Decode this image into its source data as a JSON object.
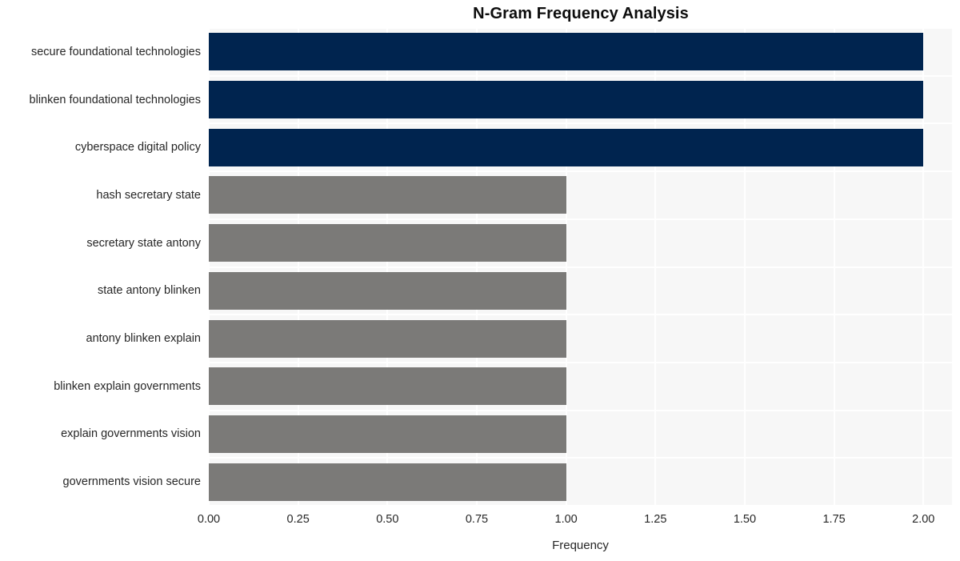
{
  "chart_data": {
    "type": "bar",
    "orientation": "horizontal",
    "title": "N-Gram Frequency Analysis",
    "xlabel": "Frequency",
    "ylabel": "",
    "xlim": [
      0,
      2.08
    ],
    "xticks": [
      "0.00",
      "0.25",
      "0.50",
      "0.75",
      "1.00",
      "1.25",
      "1.50",
      "1.75",
      "2.00"
    ],
    "xtick_values": [
      0,
      0.25,
      0.5,
      0.75,
      1.0,
      1.25,
      1.5,
      1.75,
      2.0
    ],
    "grid": true,
    "legend": "none",
    "categories": [
      "secure foundational technologies",
      "blinken foundational technologies",
      "cyberspace digital policy",
      "hash secretary state",
      "secretary state antony",
      "state antony blinken",
      "antony blinken explain",
      "blinken explain governments",
      "explain governments vision",
      "governments vision secure"
    ],
    "values": [
      2,
      2,
      2,
      1,
      1,
      1,
      1,
      1,
      1,
      1
    ],
    "bar_colors": [
      "#00244f",
      "#00244f",
      "#00244f",
      "#7b7a78",
      "#7b7a78",
      "#7b7a78",
      "#7b7a78",
      "#7b7a78",
      "#7b7a78",
      "#7b7a78"
    ],
    "colors": {
      "highlight": "#00244f",
      "standard": "#7b7a78",
      "plot_background": "#f7f7f7",
      "figure_background": "#ffffff",
      "gridline": "#ffffff",
      "text": "#262626",
      "title_text": "#0d0d0d"
    }
  }
}
